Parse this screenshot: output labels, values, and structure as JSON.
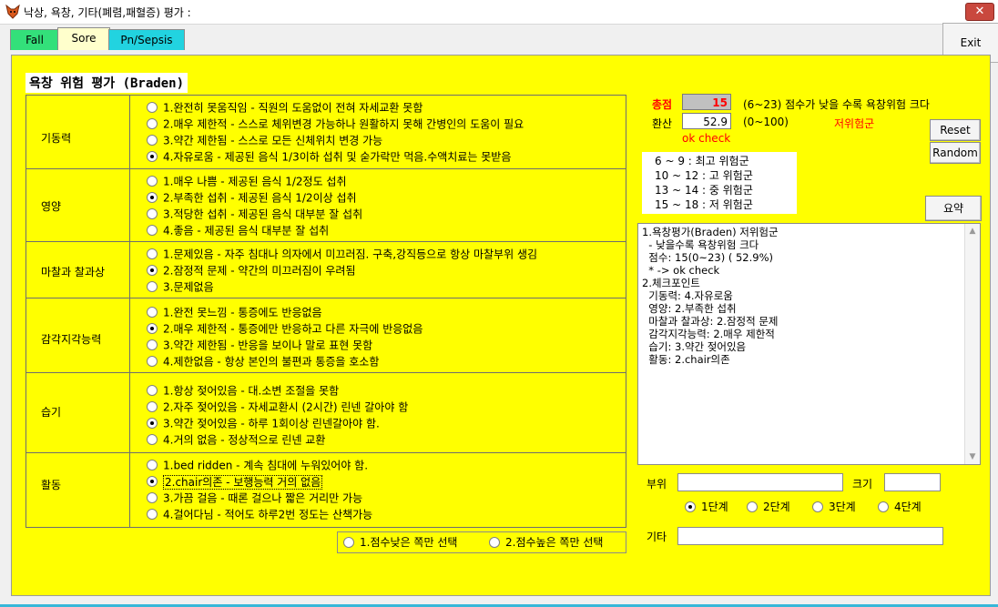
{
  "window": {
    "title": "낙상, 욕창, 기타(폐렴,패혈증) 평가 :",
    "close_label": "✕"
  },
  "tabs": [
    {
      "label": "Fall",
      "color": "#33e07a"
    },
    {
      "label": "Sore",
      "color": "#ffffcc",
      "active": true
    },
    {
      "label": "Pn/Sepsis",
      "color": "#22d3e0"
    }
  ],
  "exit_label": "Exit",
  "colors": {
    "panel": "#ffff00",
    "score_red": "#ff0000",
    "taskbar_accent": "#37b7d8"
  },
  "section_title": "욕창 위험 평가 (Braden)",
  "categories": [
    {
      "label": "기동력",
      "options": [
        {
          "text": "1.완전히 못움직임 - 직원의 도움없이 전혀 자세교환 못함",
          "selected": false
        },
        {
          "text": "2.매우 제한적 - 스스로 체위변경 가능하나 원활하지 못해 간병인의 도움이 필요",
          "selected": false
        },
        {
          "text": "3.약간 제한됨 -  스스로 모든 신체위치 변경 가능",
          "selected": false
        },
        {
          "text": "4.자유로움 - 제공된 음식 1/3이하 섭취 및 숟가락만 먹음.수액치료는 못받음",
          "selected": true
        }
      ]
    },
    {
      "label": "영양",
      "options": [
        {
          "text": "1.매우 나쁨 - 제공된 음식 1/2정도 섭취",
          "selected": false
        },
        {
          "text": "2.부족한 섭취 - 제공된 음식 1/2이상 섭취",
          "selected": true
        },
        {
          "text": "3.적당한 섭취 - 제공된 음식 대부분 잘 섭취",
          "selected": false
        },
        {
          "text": "4.좋음 - 제공된 음식 대부분 잘 섭취",
          "selected": false
        }
      ]
    },
    {
      "label": "마찰과 찰과상",
      "options": [
        {
          "text": "1.문제있음 - 자주 침대나 의자에서 미끄러짐. 구축,강직등으로 항상 마찰부위 생김",
          "selected": false
        },
        {
          "text": "2.잠정적 문제 - 약간의 미끄러짐이 우려됨",
          "selected": true
        },
        {
          "text": "3.문제없음",
          "selected": false
        }
      ]
    },
    {
      "label": "감각지각능력",
      "options": [
        {
          "text": "1.완전 못느낌 - 통증에도 반응없음",
          "selected": false
        },
        {
          "text": "2.매우 제한적 - 통증에만 반응하고 다른 자극에 반응없음",
          "selected": true
        },
        {
          "text": "3.약간 제한됨 - 반응을 보이나 말로 표현 못함",
          "selected": false
        },
        {
          "text": "4.제한없음 - 항상 본인의 불편과 통증을 호소함",
          "selected": false
        }
      ]
    },
    {
      "label": "습기",
      "options": [
        {
          "text": "1.항상 젖어있음 - 대.소변 조절을 못함",
          "selected": false
        },
        {
          "text": "2.자주 젖어있음 - 자세교환시 (2시간) 린넨 갈아야 함",
          "selected": false
        },
        {
          "text": "3.약간 젖어있음 - 하루 1회이상 린넨갈아야 함.",
          "selected": true
        },
        {
          "text": "4.거의 없음 - 정상적으로 린넨 교환",
          "selected": false
        }
      ]
    },
    {
      "label": "활동",
      "options": [
        {
          "text": "1.bed ridden - 계속 침대에 누워있어야 함.",
          "selected": false
        },
        {
          "text": "2.chair의존 - 보행능력 거의 없음",
          "selected": true,
          "focused": true
        },
        {
          "text": "3.가끔 걸음 - 때론 걸으나 짧은 거리만 가능",
          "selected": false
        },
        {
          "text": "4.걸어다님 - 적어도 하루2번 정도는 산책가능",
          "selected": false
        }
      ]
    }
  ],
  "mode_options": [
    {
      "text": "1.점수낮은 쪽만 선택",
      "selected": false
    },
    {
      "text": "2.점수높은 쪽만 선택",
      "selected": false
    }
  ],
  "score": {
    "label": "총점",
    "value": "15",
    "description": "(6~23) 점수가 낮을 수록 욕창위험 크다",
    "converted_label": "환산",
    "converted_value": "52.9",
    "converted_range": "(0~100)",
    "risk_level": "저위험군",
    "ok_check": "ok check"
  },
  "buttons": {
    "reset": "Reset",
    "random": "Random",
    "summary": "요약"
  },
  "legend": [
    " 6 ~  9 : 최고 위험군",
    "10 ~ 12 : 고 위험군",
    "13 ~ 14 : 중 위험군",
    "15 ~ 18 : 저 위험군"
  ],
  "summary_lines": [
    "1.욕창평가(Braden) 저위험군",
    "  - 낮을수록 욕창위험 크다",
    "  점수: 15(0~23) ( 52.9%)",
    "  * -> ok check",
    "",
    "2.체크포인트",
    "  기동력: 4.자유로움",
    "  영양: 2.부족한 섭취",
    "  마찰과 찰과상: 2.잠정적 문제",
    "  감각지각능력: 2.매우 제한적",
    "  습기: 3.약간 젖어있음",
    "  활동: 2.chair의존"
  ],
  "location": {
    "label": "부위",
    "value": ""
  },
  "size": {
    "label": "크기",
    "value": ""
  },
  "stages": [
    {
      "text": "1단계",
      "selected": true
    },
    {
      "text": "2단계",
      "selected": false
    },
    {
      "text": "3단계",
      "selected": false
    },
    {
      "text": "4단계",
      "selected": false
    }
  ],
  "other": {
    "label": "기타",
    "value": ""
  }
}
